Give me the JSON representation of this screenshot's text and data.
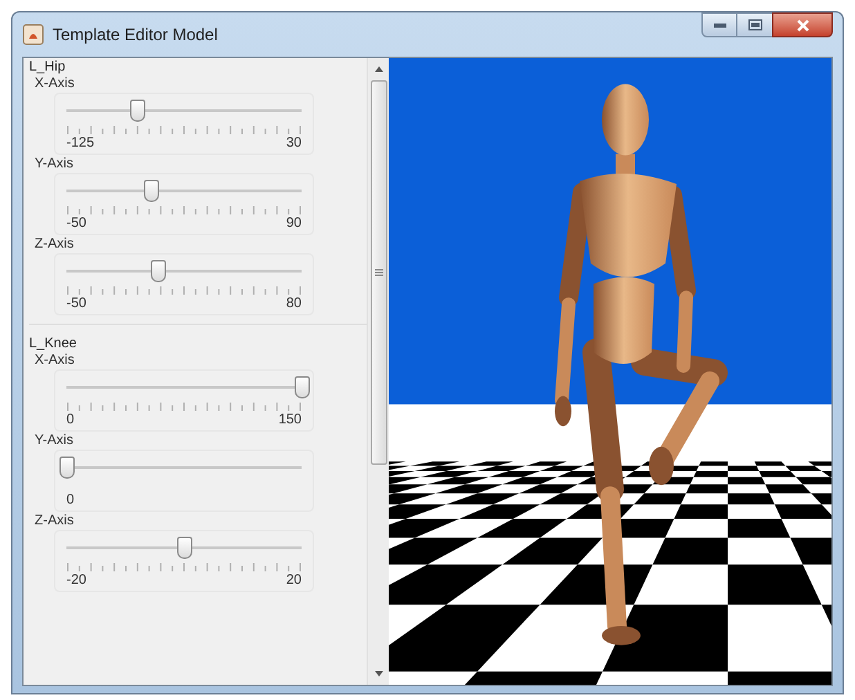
{
  "window": {
    "title": "Template Editor Model"
  },
  "joints": [
    {
      "name": "L_Hip",
      "axes": [
        {
          "label": "X-Axis",
          "kind": "ticked",
          "level": 0.3,
          "min": "-125",
          "max": "30"
        },
        {
          "label": "Y-Axis",
          "kind": "ticked",
          "level": 0.36,
          "min": "-50",
          "max": "90"
        },
        {
          "label": "Z-Axis",
          "kind": "ticked",
          "level": 0.39,
          "min": "-50",
          "max": "80"
        }
      ]
    },
    {
      "name": "L_Knee",
      "axes": [
        {
          "label": "X-Axis",
          "kind": "ticked",
          "level": 1.0,
          "min": "0",
          "max": "150"
        },
        {
          "label": "Y-Axis",
          "kind": "plain",
          "level": 0.0,
          "min": "0"
        },
        {
          "label": "Z-Axis",
          "kind": "ticked",
          "level": 0.5,
          "min": "-20",
          "max": "20"
        }
      ]
    }
  ]
}
